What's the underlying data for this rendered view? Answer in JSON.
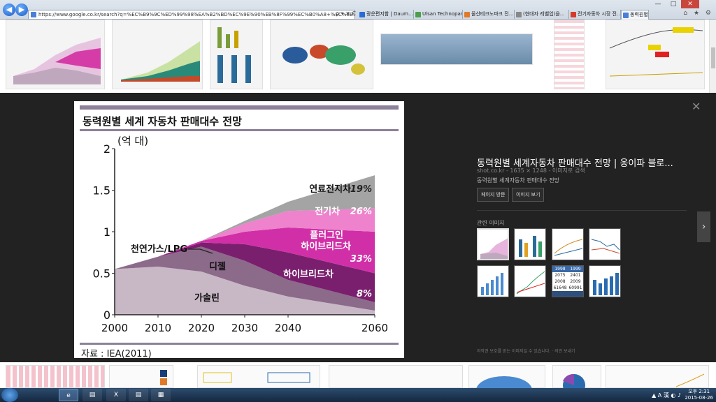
{
  "browser": {
    "address": "https://www.google.co.kr/search?q=%EC%B9%9C%ED%99%98%EA%B2%BD%EC%9E%90%EB%8F%99%EC%B0%A8+%EC%8B%9C%EC%9E%A5%EC%A0",
    "tools": "ρ ▾ ✕ C",
    "tabs": [
      {
        "label": "광운편지함 | Daum...",
        "color": "#2a6bd6"
      },
      {
        "label": "Ulsan Technopark E...",
        "color": "#4aa04a"
      },
      {
        "label": "울산테크노파크 전...",
        "color": "#e07a28"
      },
      {
        "label": "(현대자 레벨업)을...",
        "color": "#888888"
      },
      {
        "label": "전기자동차 시장 전...",
        "color": "#d63a2a"
      },
      {
        "label": "동력원별 세계 ...",
        "color": "#4a7fd8"
      }
    ],
    "window_controls": {
      "minimize": "—",
      "maximize": "□",
      "close": "✕"
    },
    "toolbar_icons": "⌂ ★ ⚙"
  },
  "viewer": {
    "close": "✕",
    "next": "›",
    "title": "동력원별 세계자동차 판매대수 전망 | 옹이파 블로...",
    "meta": "shot.co.kr  -  1635 × 1248  -  이미지로 검색",
    "description": "동력원별 세계자동차 판매대수 전망",
    "buttons": {
      "visit": "페이지 방문",
      "view": "이미지 보기"
    },
    "related_label": "관련 이미지",
    "related_table": {
      "r1": [
        "1998",
        "1999"
      ],
      "r2": [
        "2075",
        "2401"
      ],
      "r3": [
        "2008",
        "2009"
      ],
      "r4": [
        "61648",
        "60991"
      ]
    },
    "copyright": "저작권 보호를 받는 이미지일 수 있습니다.  ·  의견 보내기"
  },
  "chart_data": {
    "type": "area",
    "title": "동력원별 세계 자동차 판매대수 전망",
    "ylabel": "(억 대)",
    "source": "자료 : IEA(2011)",
    "x": [
      2000,
      2010,
      2020,
      2030,
      2040,
      2060
    ],
    "xlim": [
      2000,
      2060
    ],
    "ylim": [
      0,
      2
    ],
    "yticks": [
      0,
      0.5,
      1,
      1.5,
      2
    ],
    "ytick_labels": [
      "0",
      "0.5",
      "1",
      "1.5",
      "2"
    ],
    "series": [
      {
        "name": "가솔린",
        "values": [
          0.55,
          0.58,
          0.52,
          0.35,
          0.22,
          0.05
        ],
        "color": "#c8b8c6"
      },
      {
        "name": "디젤",
        "values": [
          0.0,
          0.12,
          0.3,
          0.3,
          0.2,
          0.1
        ],
        "color": "#8c6a8a"
      },
      {
        "name": "하이브리드차",
        "values": [
          0.0,
          0.0,
          0.05,
          0.2,
          0.33,
          0.35
        ],
        "color": "#7a1f6e"
      },
      {
        "name": "플러그인 하이브리드차",
        "values": [
          0.0,
          0.0,
          0.02,
          0.15,
          0.3,
          0.5
        ],
        "color": "#d12fa8"
      },
      {
        "name": "전기차",
        "values": [
          0.0,
          0.0,
          0.0,
          0.1,
          0.2,
          0.28
        ],
        "color": "#ee82cc"
      },
      {
        "name": "연료전지차",
        "values": [
          0.0,
          0.0,
          0.0,
          0.03,
          0.11,
          0.4
        ],
        "color": "#a4a4a4"
      }
    ],
    "annotations": [
      {
        "text": "연료전지차",
        "color": "#111111"
      },
      {
        "text": "19%",
        "color": "#222222"
      },
      {
        "text": "전기차",
        "color": "#ffffff"
      },
      {
        "text": "26%",
        "color": "#ffffff"
      },
      {
        "text": "플러그인",
        "color": "#ffffff"
      },
      {
        "text": "하이브리드차",
        "color": "#ffffff"
      },
      {
        "text": "33%",
        "color": "#ffffff"
      },
      {
        "text": "천연가스/LPG",
        "color": "#111111"
      },
      {
        "text": "디젤",
        "color": "#111111"
      },
      {
        "text": "하이브리드차",
        "color": "#ffffff"
      },
      {
        "text": "8%",
        "color": "#ffffff"
      },
      {
        "text": "가솔린",
        "color": "#111111"
      }
    ]
  },
  "taskbar": {
    "apps": [
      "e",
      "▤",
      "X",
      "▤",
      "▦"
    ],
    "tray": "▲ A 漢 ◐ ♪",
    "time": "오후 2:31",
    "date": "2015-08-26"
  }
}
